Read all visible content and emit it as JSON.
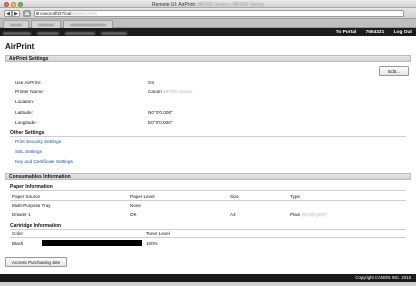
{
  "window": {
    "title_prefix": "Remote UI: AirPrint:",
    "title_blur": "MF000 Series / MF000 Series"
  },
  "browser": {
    "back_label": "◀",
    "forward_label": "▶",
    "url_visible": "canon4f027/oal",
    "url_blur": "/airprint.html",
    "tabs": [
      "",
      "",
      ""
    ]
  },
  "header": {
    "to_portal": "To Portal",
    "user_id": "7654321",
    "logout": "Log Out"
  },
  "page": {
    "title": "AirPrint",
    "airprint_settings_label": "AirPrint Settings",
    "edit_label": "Edit...",
    "fields": [
      {
        "label": "Use AirPrint:",
        "value": "On"
      },
      {
        "label": "Printer Name:",
        "value": "Canon",
        "value_blur": "MF000 Series"
      },
      {
        "label": "Location:",
        "value": ""
      },
      {
        "label": "Latitude:",
        "value": "N0°0'0.000\""
      },
      {
        "label": "Longitude:",
        "value": "E0°0'0.000\""
      }
    ],
    "other_settings_label": "Other Settings",
    "links": [
      "Print Security Settings",
      "SSL Settings",
      "Key and Certificate Settings"
    ],
    "consumables_label": "Consumables Information",
    "paper_info_label": "Paper Information",
    "paper_headers": [
      "Paper Source",
      "Paper Level",
      "Size",
      "Type"
    ],
    "paper_rows": [
      {
        "source": "Multi-Purpose Tray",
        "level": "None",
        "size": "",
        "type": "",
        "type_blur": ""
      },
      {
        "source": "Drawer 1",
        "level": "OK",
        "size": "A4",
        "type": "Plain",
        "type_blur": "(60-89 g/m²)"
      }
    ],
    "cartridge_info_label": "Cartridge Information",
    "cartridge_headers": [
      "Color",
      "Toner Level"
    ],
    "cartridge_rows": [
      {
        "color": "Black",
        "level": "100%",
        "level_fraction": 1.0
      }
    ],
    "access_label": "Access Purchasing Site"
  },
  "footer": {
    "copyright": "Copyright CANON INC. 2015"
  }
}
